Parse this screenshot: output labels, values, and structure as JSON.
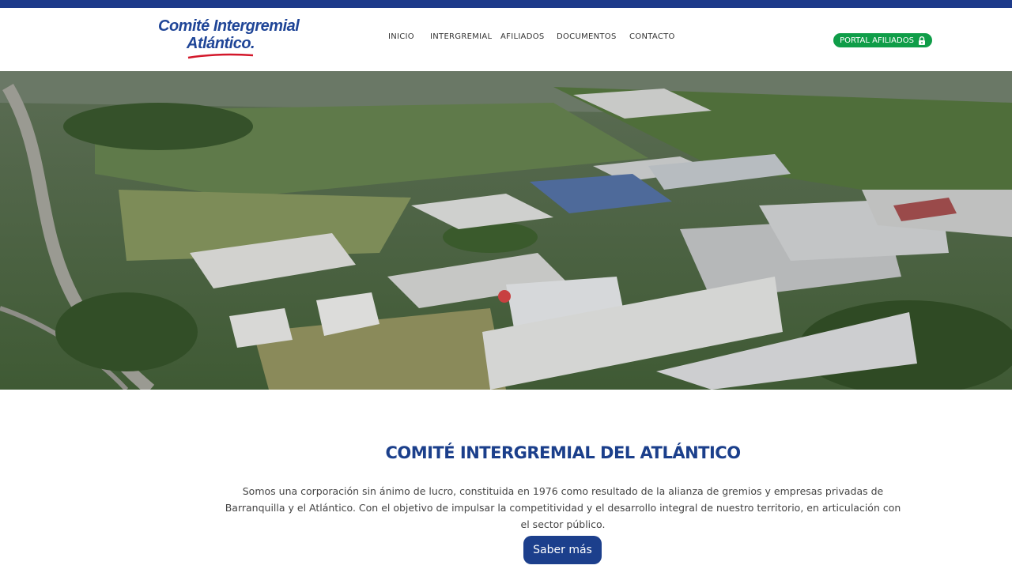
{
  "logo": {
    "line1": "Comité Intergremial",
    "line2": "Atlántico."
  },
  "nav": {
    "items": [
      {
        "label": "INICIO"
      },
      {
        "label": "INTERGREMIAL"
      },
      {
        "label": "AFILIADOS"
      },
      {
        "label": "DOCUMENTOS"
      },
      {
        "label": "CONTACTO"
      }
    ]
  },
  "portal": {
    "label": "PORTAL AFILIADOS",
    "icon": "lock-icon"
  },
  "hero": {
    "image": "aerial view of industrial park"
  },
  "content": {
    "title": "COMITÉ INTERGREMIAL DEL ATLÁNTICO",
    "description": "Somos una corporación sin ánimo de lucro, constituida en 1976 como resultado de la alianza de gremios y empresas privadas de Barranquilla y el Atlántico. Con el objetivo de impulsar la competitividad y el desarrollo integral de nuestro territorio, en articulación con el sector público.",
    "button_label": "Saber más"
  },
  "colors": {
    "brand_blue": "#1d3a8a",
    "portal_green": "#0f9d48",
    "title_blue": "#1b3f8b"
  }
}
